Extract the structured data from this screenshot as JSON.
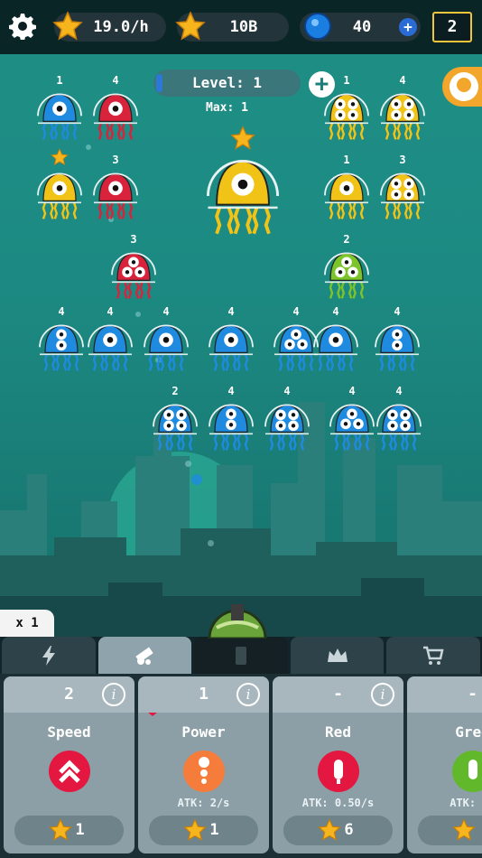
{
  "topbar": {
    "rate": "19.0/h",
    "stars": "10B",
    "gems": "40",
    "count": "2"
  },
  "level": {
    "label": "Level: 1",
    "max": "Max: 1"
  },
  "jellies": [
    {
      "id": "j1",
      "lvl": "1",
      "color": "blue",
      "eyes": 1
    },
    {
      "id": "j2",
      "lvl": "4",
      "color": "red",
      "eyes": 1
    },
    {
      "id": "j3",
      "lvl": "",
      "color": "yellow",
      "eyes": 1,
      "star": true
    },
    {
      "id": "j4",
      "lvl": "3",
      "color": "red",
      "eyes": 1
    },
    {
      "id": "j5",
      "lvl": "3",
      "color": "red",
      "eyes": 3
    },
    {
      "id": "j6",
      "lvl": "",
      "color": "yellow",
      "eyes": 1,
      "star": true,
      "big": true
    },
    {
      "id": "j7",
      "lvl": "1",
      "color": "yellow",
      "eyes": 4
    },
    {
      "id": "j8",
      "lvl": "4",
      "color": "yellow",
      "eyes": 4
    },
    {
      "id": "j9",
      "lvl": "1",
      "color": "yellow",
      "eyes": 1
    },
    {
      "id": "j10",
      "lvl": "3",
      "color": "yellow",
      "eyes": 4
    },
    {
      "id": "j11",
      "lvl": "2",
      "color": "green",
      "eyes": 3
    },
    {
      "id": "j12",
      "lvl": "4",
      "color": "blue",
      "eyes": 2
    },
    {
      "id": "j13",
      "lvl": "4",
      "color": "blue",
      "eyes": 1
    },
    {
      "id": "j14",
      "lvl": "4",
      "color": "blue",
      "eyes": 1
    },
    {
      "id": "j15",
      "lvl": "4",
      "color": "blue",
      "eyes": 1
    },
    {
      "id": "j16",
      "lvl": "4",
      "color": "blue",
      "eyes": 3
    },
    {
      "id": "j17",
      "lvl": "4",
      "color": "blue",
      "eyes": 1
    },
    {
      "id": "j18",
      "lvl": "4",
      "color": "blue",
      "eyes": 2
    },
    {
      "id": "j19",
      "lvl": "2",
      "color": "blue",
      "eyes": 4
    },
    {
      "id": "j20",
      "lvl": "4",
      "color": "blue",
      "eyes": 2
    },
    {
      "id": "j21",
      "lvl": "4",
      "color": "blue",
      "eyes": 4
    },
    {
      "id": "j22",
      "lvl": "4",
      "color": "blue",
      "eyes": 3
    },
    {
      "id": "j23",
      "lvl": "4",
      "color": "blue",
      "eyes": 4
    }
  ],
  "multiplier": "x 1",
  "tabs": [
    {
      "name": "boost",
      "icon": "lightning-icon"
    },
    {
      "name": "cannon",
      "icon": "cannon-icon"
    },
    {
      "name": "card",
      "icon": "card-icon"
    },
    {
      "name": "crown",
      "icon": "crown-icon"
    },
    {
      "name": "shop",
      "icon": "cart-icon"
    }
  ],
  "cards": [
    {
      "num": "2",
      "title": "Speed",
      "atk": "",
      "cost": "1",
      "color": "#e3173f",
      "icon": "double-chevron-up-icon"
    },
    {
      "num": "1",
      "title": "Power",
      "atk": "ATK: 2/s",
      "cost": "1",
      "color": "#f57c3a",
      "icon": "bullet-icon"
    },
    {
      "num": "-",
      "title": "Red",
      "atk": "ATK: 0.50/s",
      "cost": "6",
      "color": "#e3173f",
      "icon": "red-bullet-icon"
    },
    {
      "num": "-",
      "title": "Gree",
      "atk": "ATK: 0.",
      "cost": "",
      "color": "#61b82a",
      "icon": "green-bullet-icon"
    }
  ],
  "colors": {
    "blue": "#1e8be0",
    "red": "#d9233c",
    "yellow": "#f2c317",
    "green": "#7bc52a",
    "accent": "#f2a62b"
  }
}
